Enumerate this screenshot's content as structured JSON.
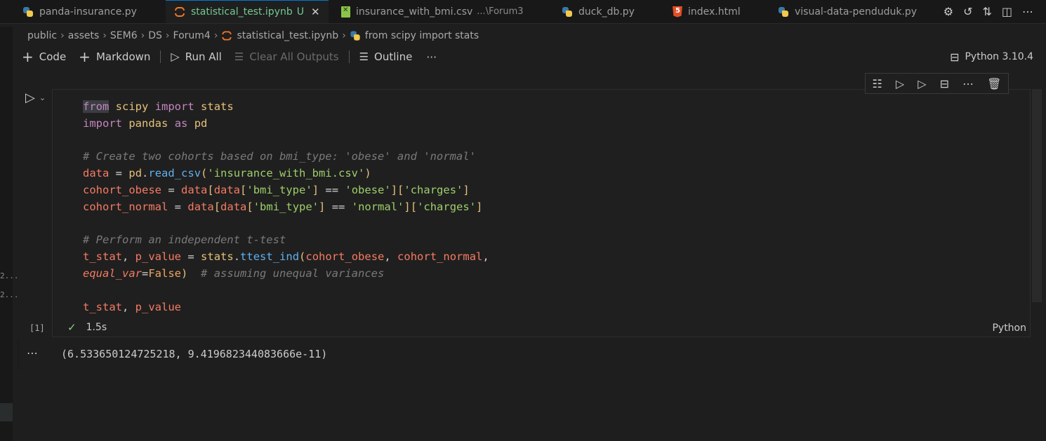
{
  "tabs": [
    {
      "label": "panda-insurance.py",
      "icon": "python-icon"
    },
    {
      "label": "statistical_test.ipynb",
      "modified": "U",
      "icon": "jupyter-icon",
      "active": true
    },
    {
      "label": "insurance_with_bmi.csv",
      "description": "...\\Forum3",
      "icon": "csv-icon"
    },
    {
      "label": "duck_db.py",
      "icon": "python-icon"
    },
    {
      "label": "index.html",
      "icon": "html-icon"
    },
    {
      "label": "visual-data-penduduk.py",
      "icon": "python-icon"
    }
  ],
  "breadcrumb": [
    "public",
    "assets",
    "SEM6",
    "DS",
    "Forum4",
    "statistical_test.ipynb",
    "from scipy import stats"
  ],
  "toolbar": {
    "code_label": "Code",
    "markdown_label": "Markdown",
    "run_all_label": "Run All",
    "clear_outputs_label": "Clear All Outputs",
    "outline_label": "Outline"
  },
  "kernel": "Python 3.10.4",
  "cell": {
    "execution_count": "[1]",
    "duration": "1.5s",
    "language": "Python",
    "output": "(6.533650124725218, 9.419682344083666e-11)"
  },
  "gutter": [
    "2...",
    "2..."
  ]
}
